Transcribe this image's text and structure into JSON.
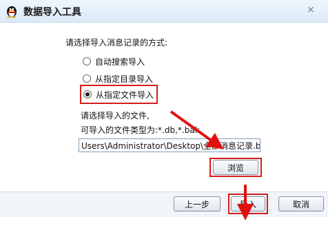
{
  "window": {
    "title": "数据导入工具",
    "close_glyph": "✕"
  },
  "prompt": "请选择导入消息记录的方式:",
  "options": [
    {
      "label": "自动搜索导入",
      "selected": false
    },
    {
      "label": "从指定目录导入",
      "selected": false
    },
    {
      "label": "从指定文件导入",
      "selected": true
    }
  ],
  "file": {
    "label": "请选择导入的文件,",
    "types_label": "可导入的文件类型为:*.db,*.bak",
    "path_value": "Users\\Administrator\\Desktop\\全部消息记录.bak",
    "browse_label": "浏览"
  },
  "footer": {
    "prev_label": "上一步",
    "import_label": "导入",
    "cancel_label": "取消"
  },
  "colors": {
    "highlight": "#d61c1c",
    "titlebar": "#dbeaf8"
  }
}
